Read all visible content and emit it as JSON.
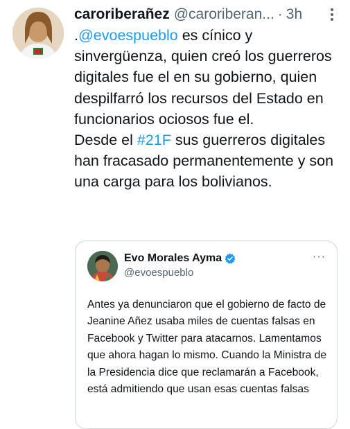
{
  "tweet": {
    "author_name": "caroriberañez",
    "author_handle": "@caroriberan...",
    "separator": "·",
    "time": "3h",
    "mention": "@evoespueblo",
    "text_lead": ".",
    "text_after_mention": " es cínico y sinvergüenza, quien creó los guerreros digitales fue el en su gobierno, quien despilfarró los recursos del Estado en funcionarios ociosos fue el.",
    "text_before_hashtag": "Desde el ",
    "hashtag": "#21F",
    "text_after_hashtag": " sus guerreros digitales han fracasado permanentemente y son una carga para los bolivianos."
  },
  "quoted_tweet": {
    "author_name": "Evo Morales Ayma",
    "author_handle": "@evoespueblo",
    "more": "···",
    "text": "Antes ya denunciaron que el gobierno de facto de Jeanine Añez usaba miles de cuentas falsas en Facebook y Twitter para atacarnos. Lamentamos que ahora hagan lo mismo. Cuando la Ministra de la Presidencia dice que reclamarán a Facebook, está admitiendo que usan esas cuentas falsas"
  },
  "colors": {
    "link": "#1d9bf0",
    "secondary_text": "#536471",
    "border": "#cfd9de"
  },
  "icons": {
    "more": "more-vertical-icon",
    "verified": "verified-badge-icon"
  }
}
